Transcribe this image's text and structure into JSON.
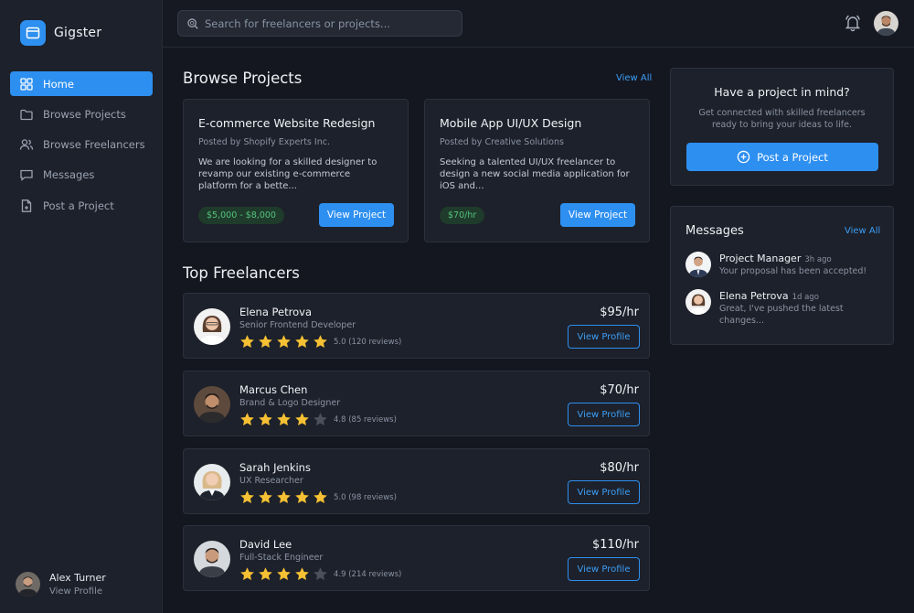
{
  "app": {
    "name": "Gigster"
  },
  "colors": {
    "accent": "#2d8ff0",
    "background": "#141720",
    "panel": "#1d212b",
    "budget_green": "#55c47f",
    "star_gold": "#f5c033",
    "star_empty": "#4a505c"
  },
  "sidebar": {
    "items": [
      {
        "label": "Home",
        "icon": "home-grid-icon",
        "active": true
      },
      {
        "label": "Browse Projects",
        "icon": "folder-icon",
        "active": false
      },
      {
        "label": "Browse Freelancers",
        "icon": "users-icon",
        "active": false
      },
      {
        "label": "Messages",
        "icon": "message-icon",
        "active": false
      },
      {
        "label": "Post a Project",
        "icon": "file-plus-icon",
        "active": false
      }
    ],
    "user": {
      "name": "Alex Turner",
      "link": "View Profile"
    }
  },
  "topbar": {
    "search_placeholder": "Search for freelancers or projects...",
    "bell_icon": "bell-icon"
  },
  "browse": {
    "title": "Browse Projects",
    "view_all": "View All",
    "projects": [
      {
        "title": "E-commerce Website Redesign",
        "posted_by": "Posted by Shopify Experts Inc.",
        "description": "We are looking for a skilled designer to revamp our existing e-commerce platform for a bette...",
        "budget": "$5,000 - $8,000",
        "button": "View Project"
      },
      {
        "title": "Mobile App UI/UX Design",
        "posted_by": "Posted by Creative Solutions",
        "description": "Seeking a talented UI/UX freelancer to design a new social media application for iOS and...",
        "budget": "$70/hr",
        "button": "View Project"
      }
    ]
  },
  "freelancers": {
    "title": "Top Freelancers",
    "items": [
      {
        "name": "Elena Petrova",
        "role": "Senior Frontend Developer",
        "stars": 5,
        "rating": "5.0 (120 reviews)",
        "rate": "$95/hr",
        "button": "View Profile"
      },
      {
        "name": "Marcus Chen",
        "role": "Brand & Logo Designer",
        "stars": 4,
        "rating": "4.8 (85 reviews)",
        "rate": "$70/hr",
        "button": "View Profile"
      },
      {
        "name": "Sarah Jenkins",
        "role": "UX Researcher",
        "stars": 5,
        "rating": "5.0 (98 reviews)",
        "rate": "$80/hr",
        "button": "View Profile"
      },
      {
        "name": "David Lee",
        "role": "Full-Stack Engineer",
        "stars": 4,
        "rating": "4.9 (214 reviews)",
        "rate": "$110/hr",
        "button": "View Profile"
      }
    ]
  },
  "cta": {
    "title": "Have a project in mind?",
    "subtitle_line1": "Get connected with skilled freelancers",
    "subtitle_line2": "ready to bring your ideas to life.",
    "button": "Post a Project"
  },
  "messages": {
    "title": "Messages",
    "view_all": "View All",
    "items": [
      {
        "name": "Project Manager",
        "time": "3h ago",
        "text": "Your proposal has been accepted!"
      },
      {
        "name": "Elena Petrova",
        "time": "1d ago",
        "text": "Great, I've pushed the latest changes..."
      }
    ]
  }
}
